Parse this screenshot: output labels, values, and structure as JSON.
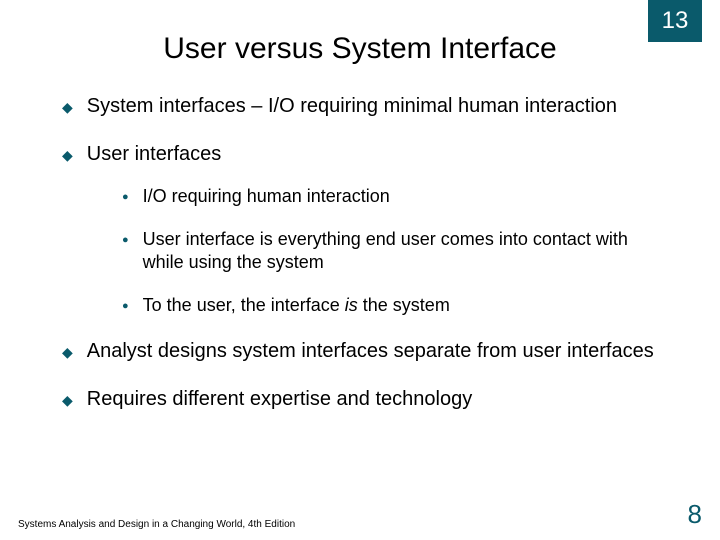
{
  "chapter_number": "13",
  "title": "User versus System Interface",
  "bullets": {
    "b1": "System interfaces – I/O requiring minimal human interaction",
    "b2": "User interfaces",
    "b2_1": "I/O requiring human interaction",
    "b2_2": "User interface is everything end user comes into contact with while using the system",
    "b2_3_a": "To the user, the interface ",
    "b2_3_em": "is",
    "b2_3_b": " the system",
    "b3": "Analyst designs system interfaces separate from user interfaces",
    "b4": "Requires different expertise and technology"
  },
  "footer": "Systems Analysis and Design in a Changing World, 4th Edition",
  "page_number": "8"
}
